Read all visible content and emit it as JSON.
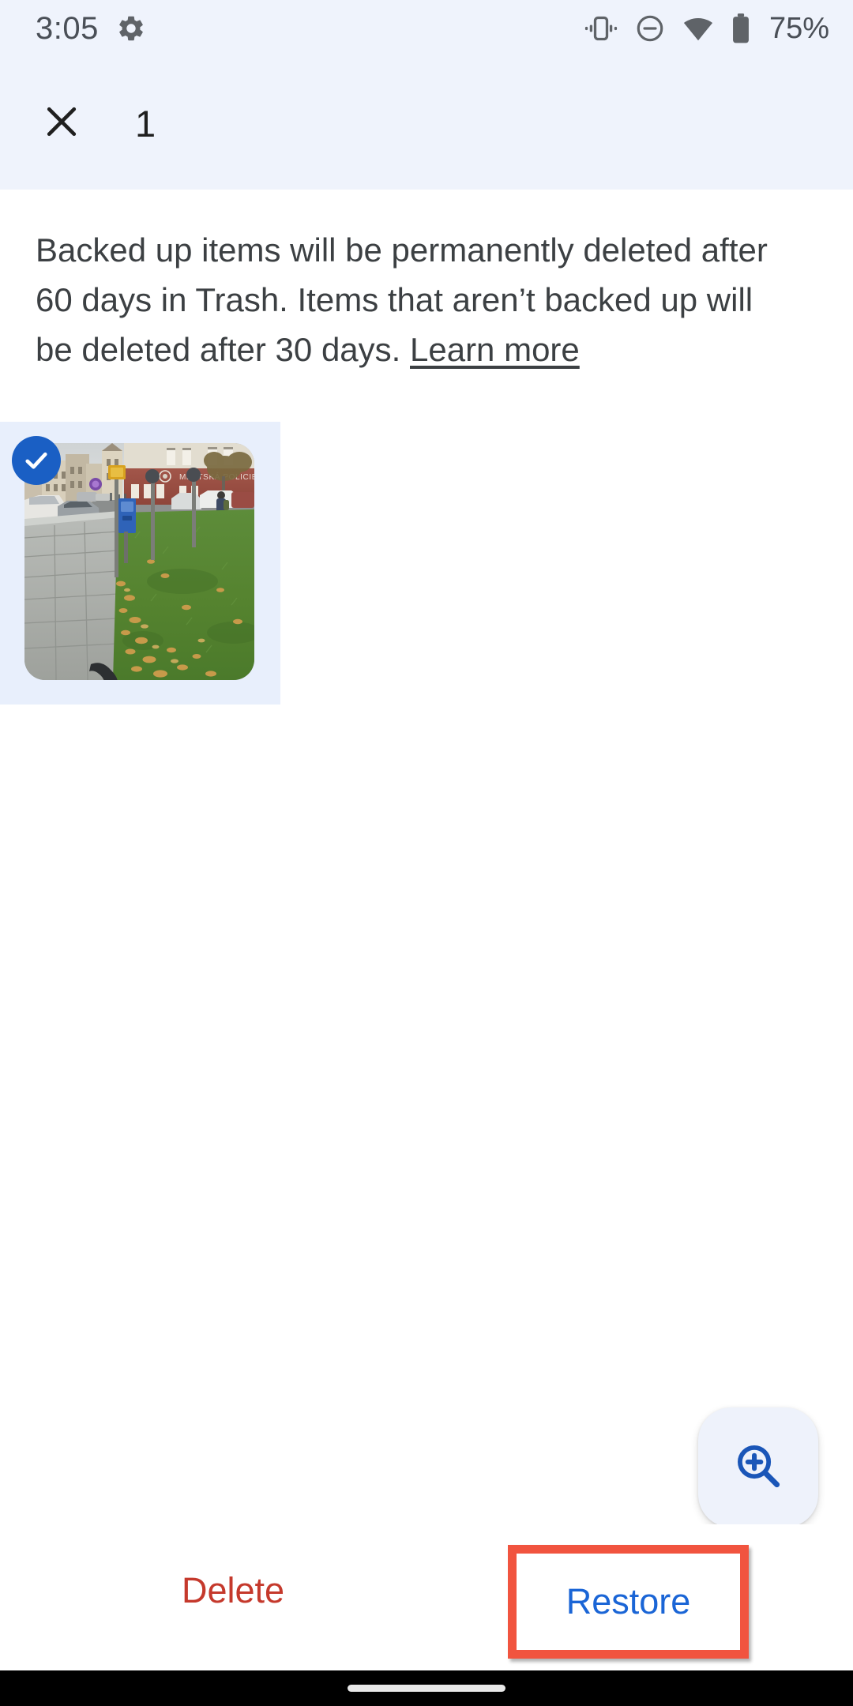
{
  "status_bar": {
    "time": "3:05",
    "battery_percent": "75%",
    "icons": [
      "gear-icon",
      "vibrate-icon",
      "do-not-disturb-icon",
      "wifi-icon",
      "battery-icon"
    ]
  },
  "app_bar": {
    "close_label": "close-icon",
    "selection_count": "1"
  },
  "notice": {
    "text": "Backed up items will be permanently deleted after 60 days in Trash. Items that aren’t backed up will be deleted after 30 days. ",
    "learn_more_label": "Learn more"
  },
  "photo_item": {
    "selected": true,
    "check_icon": "check-icon",
    "alt": "Street scene with sidewalk, grass with autumn leaves, parked cars and buildings"
  },
  "fab": {
    "icon": "zoom-in-icon"
  },
  "action_bar": {
    "delete_label": "Delete",
    "restore_label": "Restore"
  },
  "colors": {
    "header_bg": "#eff3fc",
    "tile_bg": "#e8effc",
    "check_blue": "#1a5fc4",
    "delete_red": "#c5392c",
    "restore_blue": "#1a65d6",
    "highlight_red": "#f1543f",
    "text_gray": "#3c4043",
    "fab_bg": "#eef2fb"
  }
}
